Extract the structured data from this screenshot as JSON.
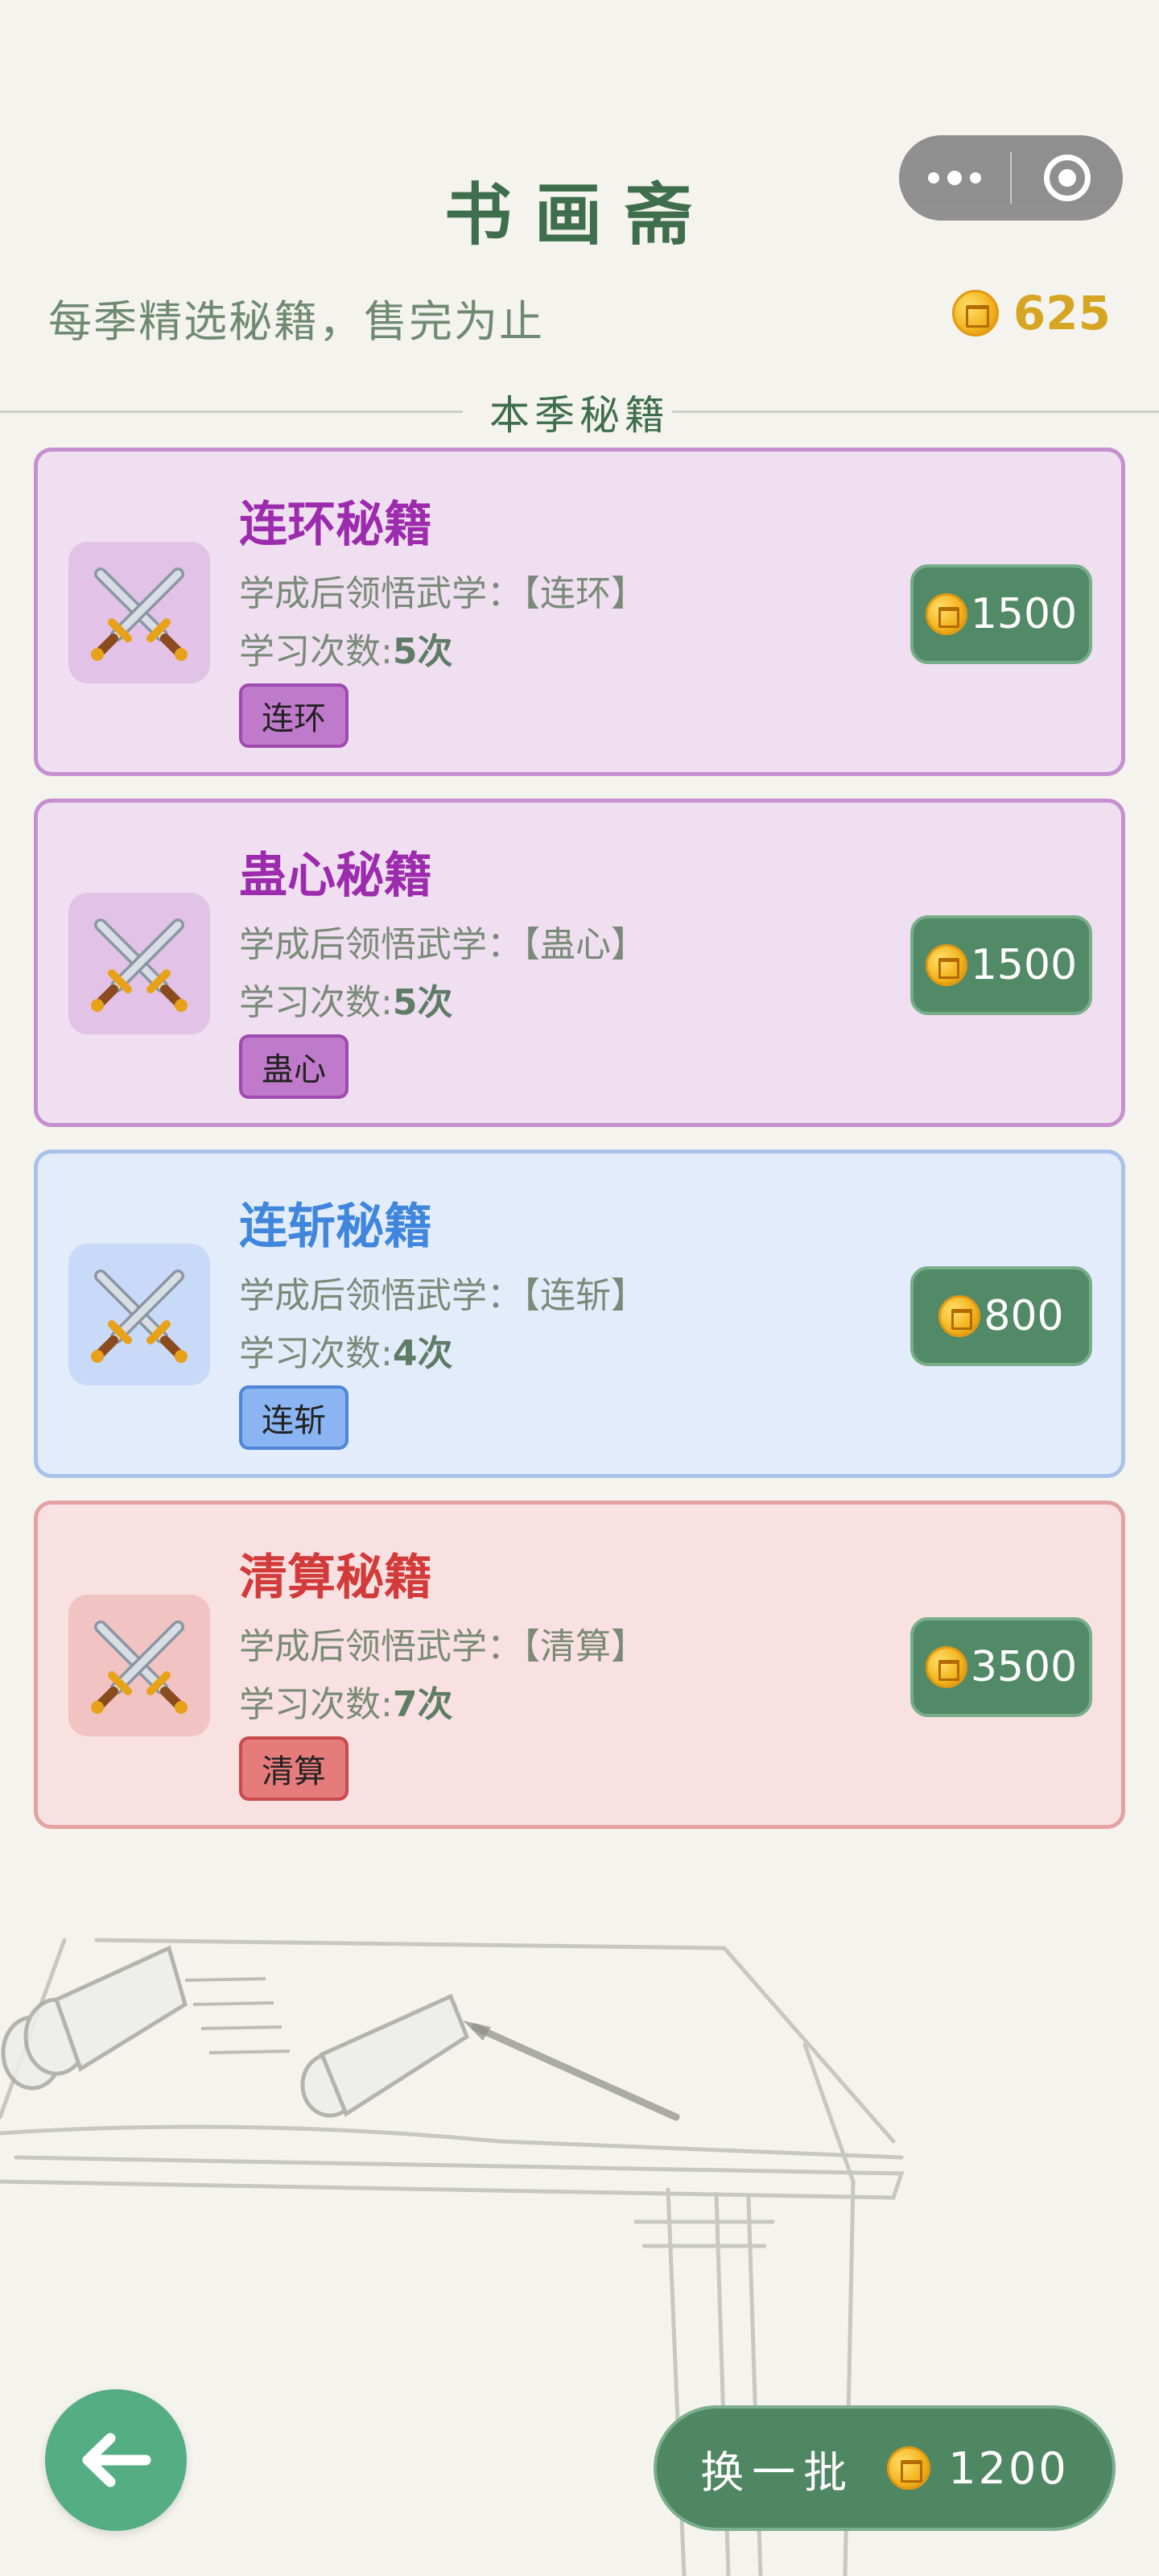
{
  "header": {
    "title": "书画斋",
    "subtitle": "每季精选秘籍，售完为止",
    "coin_balance": "625"
  },
  "section": {
    "label": "本季秘籍"
  },
  "labels": {
    "learn_prefix": "学成后领悟武学：",
    "times_prefix": "学习次数:"
  },
  "books": [
    {
      "name": "连环秘籍",
      "skill": "【连环】",
      "times": "5次",
      "tag": "连环",
      "price": "1500",
      "theme": "purple"
    },
    {
      "name": "蛊心秘籍",
      "skill": "【蛊心】",
      "times": "5次",
      "tag": "蛊心",
      "price": "1500",
      "theme": "purple"
    },
    {
      "name": "连斩秘籍",
      "skill": "【连斩】",
      "times": "4次",
      "tag": "连斩",
      "price": "800",
      "theme": "blue"
    },
    {
      "name": "清算秘籍",
      "skill": "【清算】",
      "times": "7次",
      "tag": "清算",
      "price": "3500",
      "theme": "red"
    }
  ],
  "footer": {
    "refresh_label": "换一批",
    "refresh_cost": "1200"
  },
  "icons": {
    "book_icon": "crossed-swords-icon",
    "coin_icon": "coin-icon",
    "back_icon": "arrow-left-icon",
    "menu_icon": "more-dots-icon",
    "close_icon": "target-close-icon"
  },
  "colors": {
    "primary_green": "#4f8763",
    "purple_accent": "#9c2bad",
    "blue_accent": "#3f86dc",
    "red_accent": "#d33a3a",
    "coin_gold": "#d6a523"
  }
}
